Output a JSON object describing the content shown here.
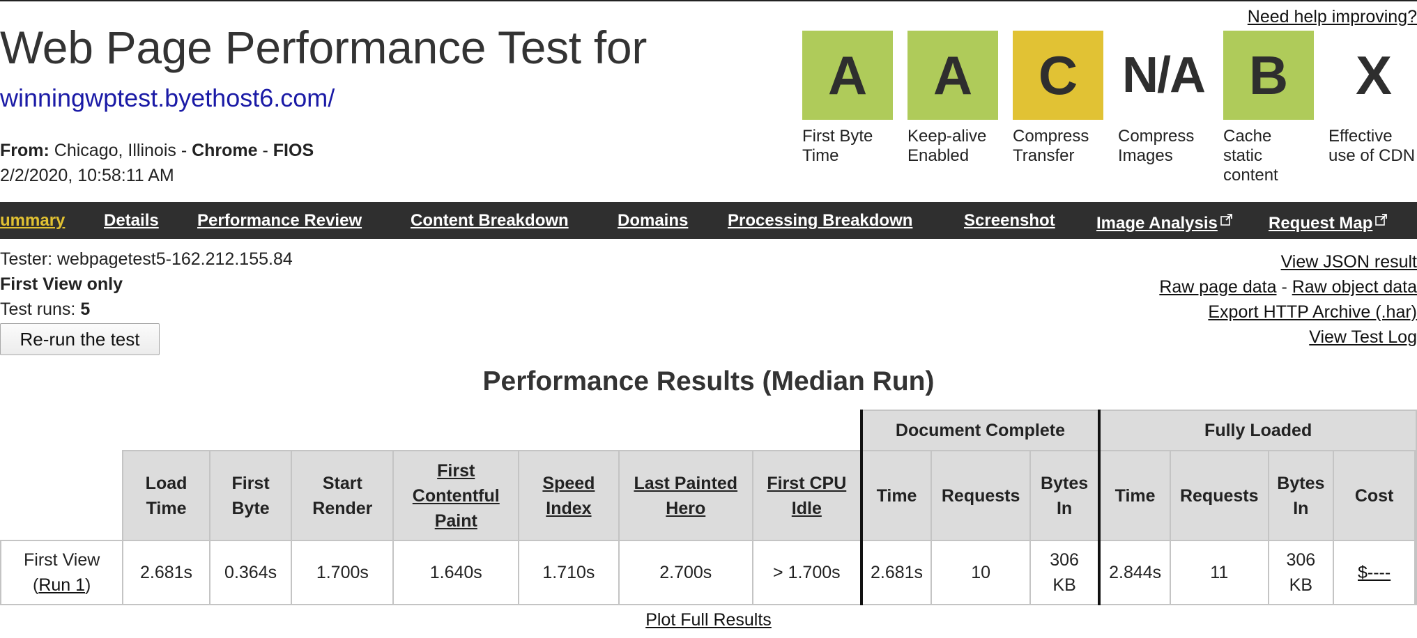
{
  "header": {
    "title": "Web Page Performance Test for",
    "url": "winningwptest.byethost6.com/",
    "from_label": "From:",
    "location": "Chicago, Illinois",
    "separator": " - ",
    "browser": "Chrome",
    "connection": "FIOS",
    "datetime": "2/2/2020, 10:58:11 AM",
    "help_link": "Need help improving?"
  },
  "grades": [
    {
      "grade": "A",
      "label_lines": [
        "First Byte",
        "Time"
      ],
      "status": "good",
      "color": "#afcb5a"
    },
    {
      "grade": "A",
      "label_lines": [
        "Keep-alive",
        "Enabled"
      ],
      "status": "good",
      "color": "#afcb5a"
    },
    {
      "grade": "C",
      "label_lines": [
        "Compress",
        "Transfer"
      ],
      "status": "warning",
      "color": "#e1c234"
    },
    {
      "grade": "N/A",
      "label_lines": [
        "Compress",
        "Images"
      ],
      "status": "none",
      "color": "#ffffff"
    },
    {
      "grade": "B",
      "label_lines": [
        "Cache",
        "static",
        "content"
      ],
      "status": "good",
      "color": "#afcb5a"
    },
    {
      "grade": "X",
      "label_lines": [
        "Effective",
        "use of CDN"
      ],
      "status": "none",
      "color": "#ffffff"
    }
  ],
  "nav": {
    "items": [
      {
        "label": "ummary",
        "active": true
      },
      {
        "label": "Details",
        "active": false
      },
      {
        "label": "Performance Review",
        "active": false
      },
      {
        "label": "Content Breakdown",
        "active": false
      },
      {
        "label": "Domains",
        "active": false
      },
      {
        "label": "Processing Breakdown",
        "active": false
      },
      {
        "label": "Screenshot",
        "active": false
      },
      {
        "label": "Image Analysis",
        "active": false,
        "external": true
      },
      {
        "label": "Request Map",
        "active": false,
        "external": true
      }
    ],
    "active_color": "#e2c232",
    "background": "#2f2f2f"
  },
  "info": {
    "tester": "Tester: webpagetest5-162.212.155.84",
    "view_mode": "First View only",
    "runs_label": "Test runs: ",
    "runs_value": "5",
    "rerun_button": "Re-run the test"
  },
  "links": {
    "view_json": "View JSON result",
    "raw_page_data": "Raw page data",
    "dash": " - ",
    "raw_object_data": "Raw object data",
    "export_har": "Export HTTP Archive (.har)",
    "view_log": "View Test Log"
  },
  "results": {
    "title": "Performance Results (Median Run)",
    "groups": [
      "Document Complete",
      "Fully Loaded"
    ],
    "columns": [
      {
        "lines": [
          "Load",
          "Time"
        ],
        "link": false
      },
      {
        "lines": [
          "First",
          "Byte"
        ],
        "link": false
      },
      {
        "lines": [
          "Start",
          "Render"
        ],
        "link": false
      },
      {
        "lines": [
          "First",
          "Contentful",
          "Paint"
        ],
        "link": true
      },
      {
        "lines": [
          "Speed",
          "Index"
        ],
        "link": true
      },
      {
        "lines": [
          "Last Painted",
          "Hero"
        ],
        "link": true
      },
      {
        "lines": [
          "First CPU",
          "Idle"
        ],
        "link": true
      },
      {
        "lines": [
          "Time"
        ],
        "link": false
      },
      {
        "lines": [
          "Requests"
        ],
        "link": false
      },
      {
        "lines": [
          "Bytes",
          "In"
        ],
        "link": false
      },
      {
        "lines": [
          "Time"
        ],
        "link": false
      },
      {
        "lines": [
          "Requests"
        ],
        "link": false
      },
      {
        "lines": [
          "Bytes",
          "In"
        ],
        "link": false
      },
      {
        "lines": [
          "Cost"
        ],
        "link": false
      }
    ],
    "row": {
      "label": "First View",
      "run_prefix": "(",
      "run_link": "Run 1",
      "run_suffix": ")",
      "values": [
        "2.681s",
        "0.364s",
        "1.700s",
        "1.640s",
        "1.710s",
        "2.700s",
        "> 1.700s",
        "2.681s",
        "10",
        [
          "306",
          "KB"
        ],
        "2.844s",
        "11",
        [
          "306",
          "KB"
        ]
      ],
      "cost": "$----"
    },
    "plot_link": "Plot Full Results"
  }
}
